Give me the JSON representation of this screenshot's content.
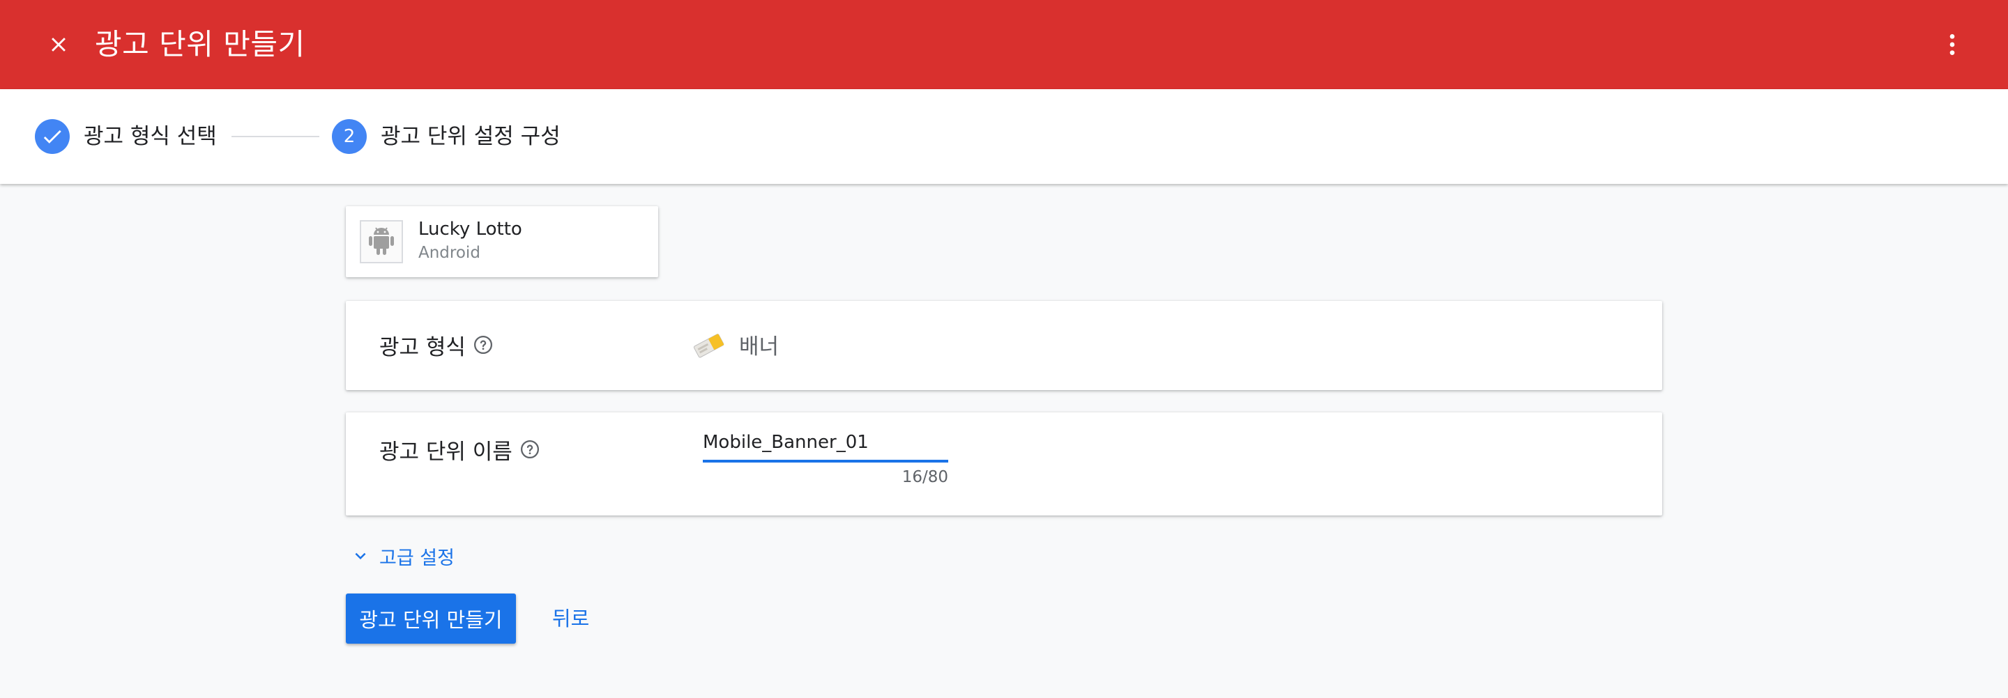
{
  "header": {
    "title": "광고 단위 만들기",
    "close_icon": "close-icon",
    "more_icon": "more-vert-icon",
    "background_color": "#d9302e"
  },
  "stepper": {
    "steps": [
      {
        "label": "광고 형식 선택",
        "status": "completed",
        "icon": "check-icon"
      },
      {
        "number": "2",
        "label": "광고 단위 설정 구성",
        "status": "active"
      }
    ],
    "accent_color": "#4285f4"
  },
  "app": {
    "name": "Lucky Lotto",
    "platform": "Android",
    "icon": "android-icon"
  },
  "format": {
    "label": "광고 형식",
    "value": "배너",
    "icon": "banner-format-icon",
    "help_icon": "help-icon"
  },
  "ad_unit_name": {
    "label": "광고 단위 이름",
    "value": "Mobile_Banner_01",
    "counter": "16/80",
    "help_icon": "help-icon"
  },
  "advanced": {
    "label": "고급 설정",
    "icon": "chevron-down-icon"
  },
  "actions": {
    "create_label": "광고 단위 만들기",
    "back_label": "뒤로"
  },
  "colors": {
    "primary": "#1a73e8",
    "page_background": "#f8f9fa"
  }
}
